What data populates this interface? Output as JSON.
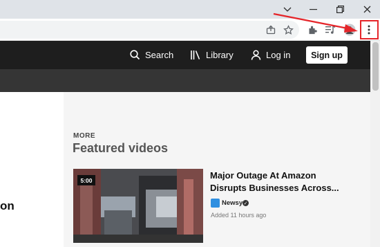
{
  "browser": {
    "window_controls": {
      "dropdown_glyph": "⌄",
      "minimize_glyph": "—",
      "restore_glyph": "❐",
      "close_glyph": "✕"
    },
    "toolbar_icons": [
      "share-icon",
      "bookmark-star-icon",
      "extensions-icon",
      "media-icon",
      "profile-icon",
      "kebab-menu-icon"
    ],
    "accent_red": "#e5252a"
  },
  "site": {
    "nav": {
      "search_label": "Search",
      "library_label": "Library",
      "login_label": "Log in",
      "signup_label": "Sign up"
    },
    "left": {
      "heading_partial": "on"
    },
    "featured": {
      "more_label": "MORE",
      "title": "Featured videos",
      "video": {
        "duration": "5:00",
        "title": "Major Outage At Amazon Disrupts Businesses Across...",
        "channel": "Newsy",
        "channel_logo_text": "newsy",
        "added": "Added 11 hours ago"
      }
    }
  }
}
